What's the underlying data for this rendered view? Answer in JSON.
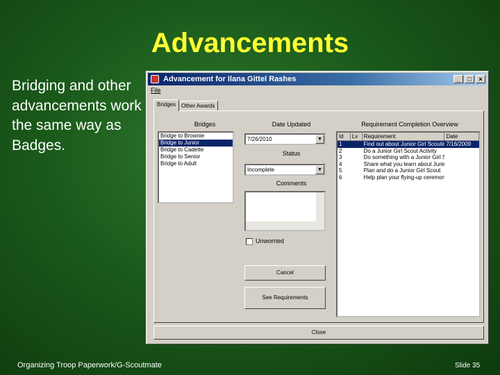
{
  "slide": {
    "title": "Advancements",
    "body": "Bridging and other advancements work the same way as Badges.",
    "footer_left": "Organizing Troop Paperwork/G-Scoutmate",
    "footer_right": "Slide 35"
  },
  "window": {
    "title": "Advancement for Ilana Gittel Rashes",
    "buttons": {
      "minimize": "_",
      "maximize": "□",
      "close": "×"
    },
    "menu": {
      "file": "File"
    },
    "tabs": [
      "Bridges",
      "Other Awards"
    ],
    "bridges": {
      "label": "Bridges",
      "items": [
        "Bridge to Brownie",
        "Bridge to Junior",
        "Bridge to Cadette",
        "Bridge to Senior",
        "Bridge to Adult"
      ],
      "selected_index": 1
    },
    "date_updated": {
      "label": "Date Updated",
      "value": "7/26/2010"
    },
    "status": {
      "label": "Status",
      "value": "Incomplete"
    },
    "comments": {
      "label": "Comments",
      "value": ""
    },
    "unworried": {
      "label": "Unworried",
      "checked": false
    },
    "cancel_label": "Cancel",
    "see_requirements_label": "See Requirements",
    "close_label": "Close",
    "requirements": {
      "label": "Requirement Completion Overview",
      "columns": [
        "Id",
        "Lv",
        "Requirement",
        "Date"
      ],
      "rows": [
        [
          "1",
          "",
          "Find out about Junior Girl Scouting",
          "7/16/2009"
        ],
        [
          "2",
          "",
          "Do a Junior Girl Scout Activity",
          ""
        ],
        [
          "3",
          "",
          "Do something with a Junior Girl S",
          ""
        ],
        [
          "4",
          "",
          "Share what you learn about Junior",
          ""
        ],
        [
          "5",
          "",
          "Plan and do a Junior Girl Scout",
          ""
        ],
        [
          "6",
          "",
          "Help plan your flying-up ceremony",
          ""
        ]
      ],
      "selected_index": 0
    }
  },
  "colors": {
    "title": "#ffff33",
    "body_text": "#ffffff",
    "titlebar": "#0a246a",
    "selection": "#0a246a"
  }
}
